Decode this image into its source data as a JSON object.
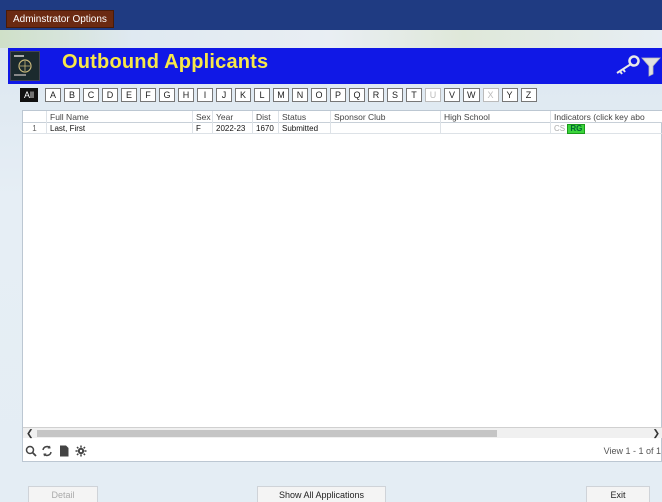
{
  "topbar": {
    "admin_button": "Adminstrator Options"
  },
  "header": {
    "title": "Outbound Applicants"
  },
  "alphabet": [
    {
      "label": "All",
      "state": "active"
    },
    {
      "label": "A",
      "state": "normal"
    },
    {
      "label": "B",
      "state": "normal"
    },
    {
      "label": "C",
      "state": "normal"
    },
    {
      "label": "D",
      "state": "normal"
    },
    {
      "label": "E",
      "state": "normal"
    },
    {
      "label": "F",
      "state": "normal"
    },
    {
      "label": "G",
      "state": "normal"
    },
    {
      "label": "H",
      "state": "normal"
    },
    {
      "label": "I",
      "state": "normal"
    },
    {
      "label": "J",
      "state": "normal"
    },
    {
      "label": "K",
      "state": "normal"
    },
    {
      "label": "L",
      "state": "normal"
    },
    {
      "label": "M",
      "state": "normal"
    },
    {
      "label": "N",
      "state": "normal"
    },
    {
      "label": "O",
      "state": "normal"
    },
    {
      "label": "P",
      "state": "normal"
    },
    {
      "label": "Q",
      "state": "normal"
    },
    {
      "label": "R",
      "state": "normal"
    },
    {
      "label": "S",
      "state": "normal"
    },
    {
      "label": "T",
      "state": "normal"
    },
    {
      "label": "U",
      "state": "disabled"
    },
    {
      "label": "V",
      "state": "normal"
    },
    {
      "label": "W",
      "state": "normal"
    },
    {
      "label": "X",
      "state": "disabled"
    },
    {
      "label": "Y",
      "state": "normal"
    },
    {
      "label": "Z",
      "state": "normal"
    }
  ],
  "grid": {
    "columns": {
      "full_name": "Full Name",
      "sex": "Sex",
      "year": "Year",
      "dist": "Dist",
      "status": "Status",
      "sponsor_club": "Sponsor Club",
      "high_school": "High School",
      "indicators": "Indicators (click key abo"
    },
    "rows": [
      {
        "num": "1",
        "full_name": "Last, First",
        "sex": "F",
        "year": "2022-23",
        "dist": "1670",
        "status": "Submitted",
        "sponsor_club": "",
        "high_school": "",
        "ind_cs": "CS",
        "ind_rg": "RG"
      }
    ],
    "view_text": "View 1 - 1 of 1"
  },
  "footer": {
    "detail": "Detail",
    "show_all": "Show All Applications",
    "exit": "Exit"
  },
  "colors": {
    "topbar": "#1f3b82",
    "header_band": "#1018e6",
    "title": "#f7e84a",
    "admin_button": "#6b2a12",
    "indicator_green": "#3bd43b"
  }
}
